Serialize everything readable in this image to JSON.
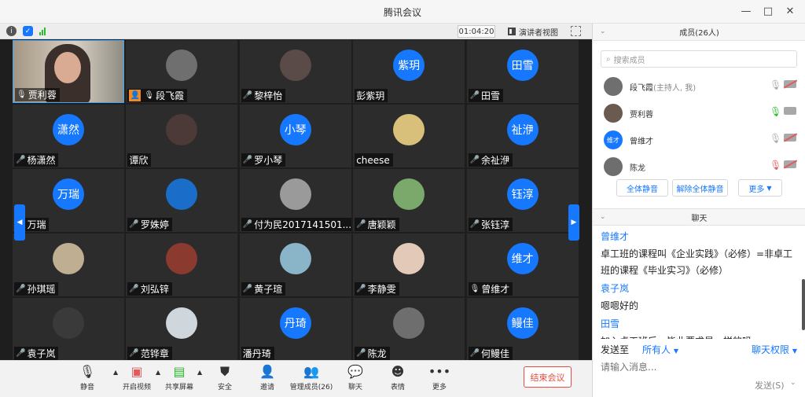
{
  "window": {
    "title": "腾讯会议",
    "minimize": "—",
    "maximize": "□",
    "close": "✕"
  },
  "topbar": {
    "timer": "01:04:20",
    "speaker_view": "演讲者视图"
  },
  "tiles": [
    {
      "name": "贾利蓉",
      "avatar_text": "",
      "avatar_color": "",
      "mic": "on",
      "video": true
    },
    {
      "name": "段飞霞",
      "avatar_text": "",
      "avatar_color": "#6f6f6f",
      "mic": "on",
      "host": true
    },
    {
      "name": "黎梓怡",
      "avatar_text": "",
      "avatar_color": "#5a4a48",
      "mic": "off"
    },
    {
      "name": "彭紫玥",
      "avatar_text": "紫玥",
      "avatar_color": "#1677ff",
      "mic": "none"
    },
    {
      "name": "田雪",
      "avatar_text": "田雪",
      "avatar_color": "#1677ff",
      "mic": "off"
    },
    {
      "name": "杨潇然",
      "avatar_text": "潇然",
      "avatar_color": "#1677ff",
      "mic": "off"
    },
    {
      "name": "谭欣",
      "avatar_text": "",
      "avatar_color": "#4b3a37",
      "mic": "none"
    },
    {
      "name": "罗小琴",
      "avatar_text": "小琴",
      "avatar_color": "#1677ff",
      "mic": "off"
    },
    {
      "name": "cheese",
      "avatar_text": "",
      "avatar_color": "#d8c07a",
      "mic": "none"
    },
    {
      "name": "余祉洢",
      "avatar_text": "祉洢",
      "avatar_color": "#1677ff",
      "mic": "off"
    },
    {
      "name": "万瑞",
      "avatar_text": "万瑞",
      "avatar_color": "#1677ff",
      "mic": "off"
    },
    {
      "name": "罗姝婷",
      "avatar_text": "",
      "avatar_color": "#1a6ec9",
      "mic": "off"
    },
    {
      "name": "付为民2017141501...",
      "avatar_text": "",
      "avatar_color": "#9a9a9a",
      "mic": "off"
    },
    {
      "name": "唐颖颖",
      "avatar_text": "",
      "avatar_color": "#7ba86b",
      "mic": "off"
    },
    {
      "name": "张钰淳",
      "avatar_text": "钰淳",
      "avatar_color": "#1677ff",
      "mic": "off"
    },
    {
      "name": "孙琪瑶",
      "avatar_text": "",
      "avatar_color": "#bfae91",
      "mic": "off"
    },
    {
      "name": "刘弘锌",
      "avatar_text": "",
      "avatar_color": "#8a3a2e",
      "mic": "off"
    },
    {
      "name": "黄子瑄",
      "avatar_text": "",
      "avatar_color": "#8ab4c8",
      "mic": "off"
    },
    {
      "name": "李静雯",
      "avatar_text": "",
      "avatar_color": "#e3c9b8",
      "mic": "off"
    },
    {
      "name": "曾维才",
      "avatar_text": "维才",
      "avatar_color": "#1677ff",
      "mic": "on"
    },
    {
      "name": "袁子岚",
      "avatar_text": "",
      "avatar_color": "#3a3a3a",
      "mic": "off"
    },
    {
      "name": "范铧章",
      "avatar_text": "",
      "avatar_color": "#cfd6dc",
      "mic": "off"
    },
    {
      "name": "潘丹琦",
      "avatar_text": "丹琦",
      "avatar_color": "#1677ff",
      "mic": "none"
    },
    {
      "name": "陈龙",
      "avatar_text": "",
      "avatar_color": "#6e6e6e",
      "mic": "off"
    },
    {
      "name": "何鳗佳",
      "avatar_text": "鳗佳",
      "avatar_color": "#1677ff",
      "mic": "off"
    }
  ],
  "toolbar": {
    "mute": "静音",
    "start_video": "开启视频",
    "share_screen": "共享屏幕",
    "security": "安全",
    "invite": "邀请",
    "manage_members": "管理成员(26)",
    "chat": "聊天",
    "emoji": "表情",
    "more": "更多",
    "end_meeting": "结束会议"
  },
  "members_panel": {
    "title": "成员(26人)",
    "search_placeholder": "搜索成员",
    "members": [
      {
        "name": "段飞霞",
        "role": "(主持人, 我)",
        "avatar_text": "",
        "avatar_color": "#6f6f6f",
        "mic": "gray",
        "cam_off": true
      },
      {
        "name": "贾利蓉",
        "role": "",
        "avatar_text": "",
        "avatar_color": "#6b5a50",
        "mic": "green",
        "cam_off": false
      },
      {
        "name": "曾维才",
        "role": "",
        "avatar_text": "维才",
        "avatar_color": "#1677ff",
        "mic": "gray",
        "cam_off": true
      },
      {
        "name": "陈龙",
        "role": "",
        "avatar_text": "",
        "avatar_color": "#6e6e6e",
        "mic": "off",
        "cam_off": true
      }
    ],
    "mute_all": "全体静音",
    "unmute_all": "解除全体静音",
    "more": "更多"
  },
  "chat_panel": {
    "title": "聊天",
    "messages": [
      {
        "sender": "曾维才",
        "text": "卓工班的课程叫《企业实践》（必修）=非卓工班的课程《毕业实习》（必修）"
      },
      {
        "sender": "袁子岚",
        "text": "嗯嗯好的"
      },
      {
        "sender": "田雪",
        "text": "加入卓工班后，毕业要求是一样的吗"
      }
    ],
    "send_to_label": "发送至",
    "send_to_value": "所有人",
    "permission": "聊天权限",
    "input_placeholder": "请输入消息...",
    "send_button": "发送(S)"
  }
}
